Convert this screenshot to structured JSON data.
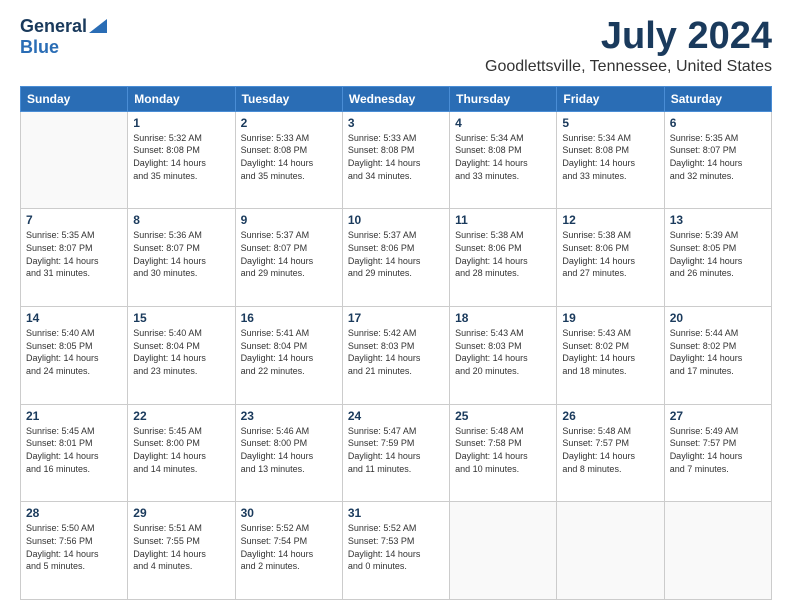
{
  "logo": {
    "general": "General",
    "blue": "Blue"
  },
  "header": {
    "month": "July 2024",
    "location": "Goodlettsville, Tennessee, United States"
  },
  "weekdays": [
    "Sunday",
    "Monday",
    "Tuesday",
    "Wednesday",
    "Thursday",
    "Friday",
    "Saturday"
  ],
  "weeks": [
    [
      null,
      {
        "day": 1,
        "sunrise": "5:32 AM",
        "sunset": "8:08 PM",
        "daylight": "14 hours and 35 minutes."
      },
      {
        "day": 2,
        "sunrise": "5:33 AM",
        "sunset": "8:08 PM",
        "daylight": "14 hours and 35 minutes."
      },
      {
        "day": 3,
        "sunrise": "5:33 AM",
        "sunset": "8:08 PM",
        "daylight": "14 hours and 34 minutes."
      },
      {
        "day": 4,
        "sunrise": "5:34 AM",
        "sunset": "8:08 PM",
        "daylight": "14 hours and 33 minutes."
      },
      {
        "day": 5,
        "sunrise": "5:34 AM",
        "sunset": "8:08 PM",
        "daylight": "14 hours and 33 minutes."
      },
      {
        "day": 6,
        "sunrise": "5:35 AM",
        "sunset": "8:07 PM",
        "daylight": "14 hours and 32 minutes."
      }
    ],
    [
      {
        "day": 7,
        "sunrise": "5:35 AM",
        "sunset": "8:07 PM",
        "daylight": "14 hours and 31 minutes."
      },
      {
        "day": 8,
        "sunrise": "5:36 AM",
        "sunset": "8:07 PM",
        "daylight": "14 hours and 30 minutes."
      },
      {
        "day": 9,
        "sunrise": "5:37 AM",
        "sunset": "8:07 PM",
        "daylight": "14 hours and 29 minutes."
      },
      {
        "day": 10,
        "sunrise": "5:37 AM",
        "sunset": "8:06 PM",
        "daylight": "14 hours and 29 minutes."
      },
      {
        "day": 11,
        "sunrise": "5:38 AM",
        "sunset": "8:06 PM",
        "daylight": "14 hours and 28 minutes."
      },
      {
        "day": 12,
        "sunrise": "5:38 AM",
        "sunset": "8:06 PM",
        "daylight": "14 hours and 27 minutes."
      },
      {
        "day": 13,
        "sunrise": "5:39 AM",
        "sunset": "8:05 PM",
        "daylight": "14 hours and 26 minutes."
      }
    ],
    [
      {
        "day": 14,
        "sunrise": "5:40 AM",
        "sunset": "8:05 PM",
        "daylight": "14 hours and 24 minutes."
      },
      {
        "day": 15,
        "sunrise": "5:40 AM",
        "sunset": "8:04 PM",
        "daylight": "14 hours and 23 minutes."
      },
      {
        "day": 16,
        "sunrise": "5:41 AM",
        "sunset": "8:04 PM",
        "daylight": "14 hours and 22 minutes."
      },
      {
        "day": 17,
        "sunrise": "5:42 AM",
        "sunset": "8:03 PM",
        "daylight": "14 hours and 21 minutes."
      },
      {
        "day": 18,
        "sunrise": "5:43 AM",
        "sunset": "8:03 PM",
        "daylight": "14 hours and 20 minutes."
      },
      {
        "day": 19,
        "sunrise": "5:43 AM",
        "sunset": "8:02 PM",
        "daylight": "14 hours and 18 minutes."
      },
      {
        "day": 20,
        "sunrise": "5:44 AM",
        "sunset": "8:02 PM",
        "daylight": "14 hours and 17 minutes."
      }
    ],
    [
      {
        "day": 21,
        "sunrise": "5:45 AM",
        "sunset": "8:01 PM",
        "daylight": "14 hours and 16 minutes."
      },
      {
        "day": 22,
        "sunrise": "5:45 AM",
        "sunset": "8:00 PM",
        "daylight": "14 hours and 14 minutes."
      },
      {
        "day": 23,
        "sunrise": "5:46 AM",
        "sunset": "8:00 PM",
        "daylight": "14 hours and 13 minutes."
      },
      {
        "day": 24,
        "sunrise": "5:47 AM",
        "sunset": "7:59 PM",
        "daylight": "14 hours and 11 minutes."
      },
      {
        "day": 25,
        "sunrise": "5:48 AM",
        "sunset": "7:58 PM",
        "daylight": "14 hours and 10 minutes."
      },
      {
        "day": 26,
        "sunrise": "5:48 AM",
        "sunset": "7:57 PM",
        "daylight": "14 hours and 8 minutes."
      },
      {
        "day": 27,
        "sunrise": "5:49 AM",
        "sunset": "7:57 PM",
        "daylight": "14 hours and 7 minutes."
      }
    ],
    [
      {
        "day": 28,
        "sunrise": "5:50 AM",
        "sunset": "7:56 PM",
        "daylight": "14 hours and 5 minutes."
      },
      {
        "day": 29,
        "sunrise": "5:51 AM",
        "sunset": "7:55 PM",
        "daylight": "14 hours and 4 minutes."
      },
      {
        "day": 30,
        "sunrise": "5:52 AM",
        "sunset": "7:54 PM",
        "daylight": "14 hours and 2 minutes."
      },
      {
        "day": 31,
        "sunrise": "5:52 AM",
        "sunset": "7:53 PM",
        "daylight": "14 hours and 0 minutes."
      },
      null,
      null,
      null
    ]
  ]
}
